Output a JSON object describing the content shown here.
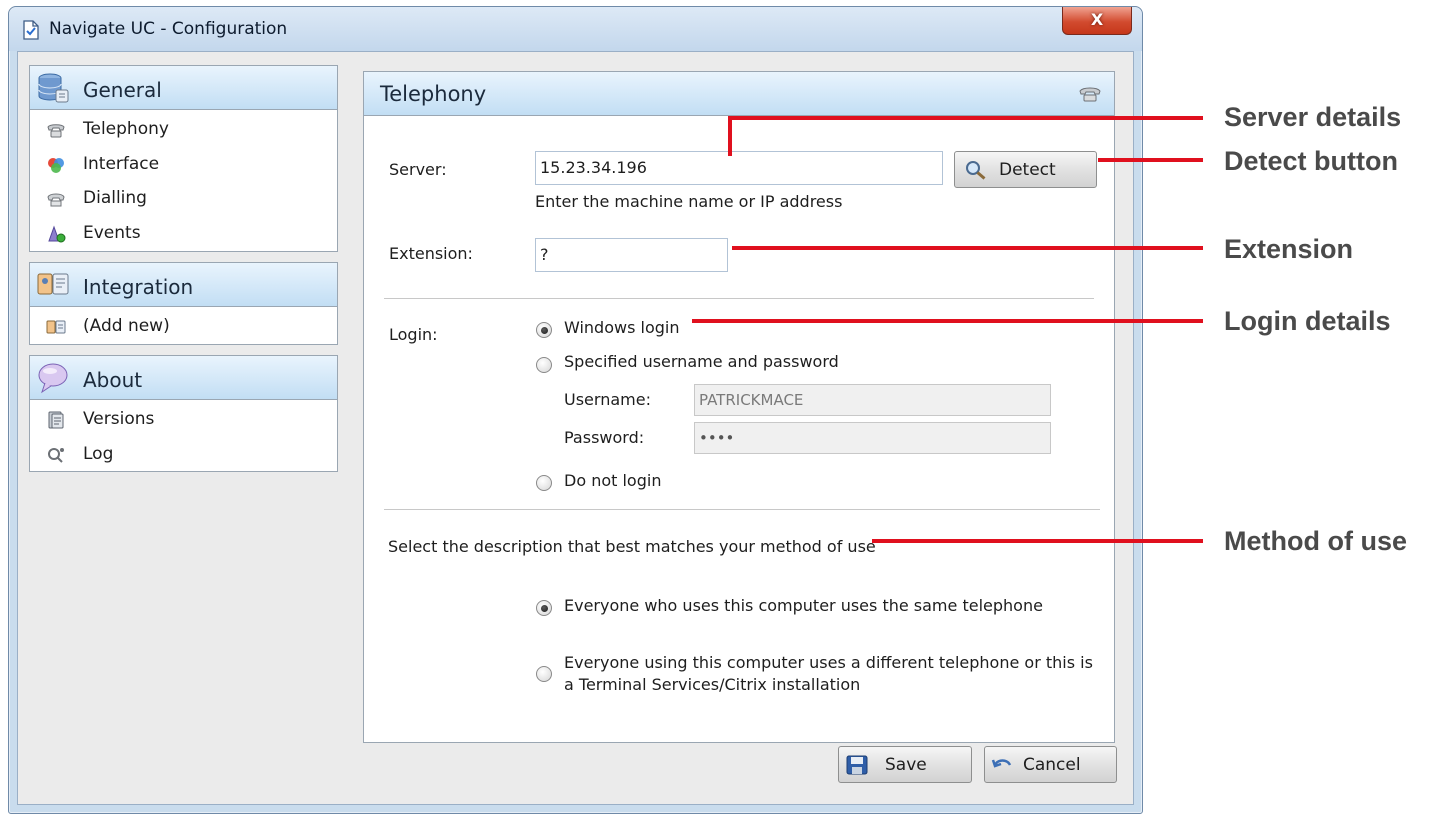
{
  "window": {
    "title": "Navigate UC - Configuration",
    "close_label": "X"
  },
  "sidebar": {
    "groups": [
      {
        "title": "General",
        "icon": "database-icon",
        "items": [
          {
            "label": "Telephony",
            "icon": "telephone-icon"
          },
          {
            "label": "Interface",
            "icon": "interface-icon"
          },
          {
            "label": "Dialling",
            "icon": "dialling-icon"
          },
          {
            "label": "Events",
            "icon": "events-icon"
          }
        ]
      },
      {
        "title": "Integration",
        "icon": "integration-icon",
        "items": [
          {
            "label": "(Add new)",
            "icon": "add-new-icon"
          }
        ]
      },
      {
        "title": "About",
        "icon": "speech-bubble-icon",
        "items": [
          {
            "label": "Versions",
            "icon": "versions-icon"
          },
          {
            "label": "Log",
            "icon": "log-icon"
          }
        ]
      }
    ]
  },
  "panel": {
    "title": "Telephony",
    "icon": "telephone-icon",
    "server": {
      "label": "Server:",
      "value": "15.23.34.196",
      "hint": "Enter the machine name or IP address",
      "detect_label": "Detect"
    },
    "extension": {
      "label": "Extension:",
      "value": "?"
    },
    "login": {
      "label": "Login:",
      "options": [
        {
          "label": "Windows login",
          "selected": true
        },
        {
          "label": "Specified username and password",
          "selected": false
        },
        {
          "label": "Do not login",
          "selected": false
        }
      ],
      "username_label": "Username:",
      "username_value": "PATRICKMACE",
      "password_label": "Password:",
      "password_value": "••••"
    },
    "method": {
      "prompt": "Select the description that best matches your method of use",
      "options": [
        {
          "line1": "Everyone who uses this computer uses the same telephone",
          "line2": "",
          "selected": true
        },
        {
          "line1": "Everyone using this computer uses a different telephone or this is",
          "line2": "a Terminal Services/Citrix installation",
          "selected": false
        }
      ]
    }
  },
  "footer": {
    "save_label": "Save",
    "cancel_label": "Cancel"
  },
  "annotations": {
    "server_details": "Server details",
    "detect_button": "Detect button",
    "extension": "Extension",
    "login_details": "Login details",
    "method_of_use": "Method of use"
  },
  "colors": {
    "callout_red": "#e0101e",
    "header_blue": "#c2def4",
    "window_frame": "#c9dced"
  }
}
